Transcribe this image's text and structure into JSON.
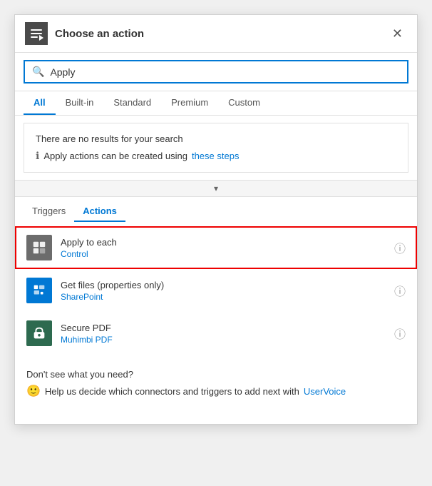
{
  "header": {
    "title": "Choose an action",
    "close_label": "✕",
    "icon_label": "action-icon"
  },
  "search": {
    "placeholder": "",
    "value": "Apply",
    "icon": "🔍"
  },
  "filter_tabs": [
    {
      "id": "all",
      "label": "All",
      "active": true
    },
    {
      "id": "built-in",
      "label": "Built-in",
      "active": false
    },
    {
      "id": "standard",
      "label": "Standard",
      "active": false
    },
    {
      "id": "premium",
      "label": "Premium",
      "active": false
    },
    {
      "id": "custom",
      "label": "Custom",
      "active": false
    }
  ],
  "no_results": {
    "title": "There are no results for your search",
    "hint_text": "Apply actions can be created using",
    "link_text": "these steps"
  },
  "sub_tabs": [
    {
      "id": "triggers",
      "label": "Triggers",
      "active": false
    },
    {
      "id": "actions",
      "label": "Actions",
      "active": true
    }
  ],
  "actions": [
    {
      "id": "apply-to-each",
      "name": "Apply to each",
      "sub": "Control",
      "icon_type": "grey",
      "highlighted": true
    },
    {
      "id": "get-files",
      "name": "Get files (properties only)",
      "sub": "SharePoint",
      "icon_type": "blue",
      "highlighted": false
    },
    {
      "id": "secure-pdf",
      "name": "Secure PDF",
      "sub": "Muhimbi PDF",
      "icon_type": "dark-green",
      "highlighted": false
    }
  ],
  "footer": {
    "title": "Don't see what you need?",
    "hint_prefix": "Help us decide which connectors and triggers to add next with",
    "link_text": "UserVoice"
  }
}
